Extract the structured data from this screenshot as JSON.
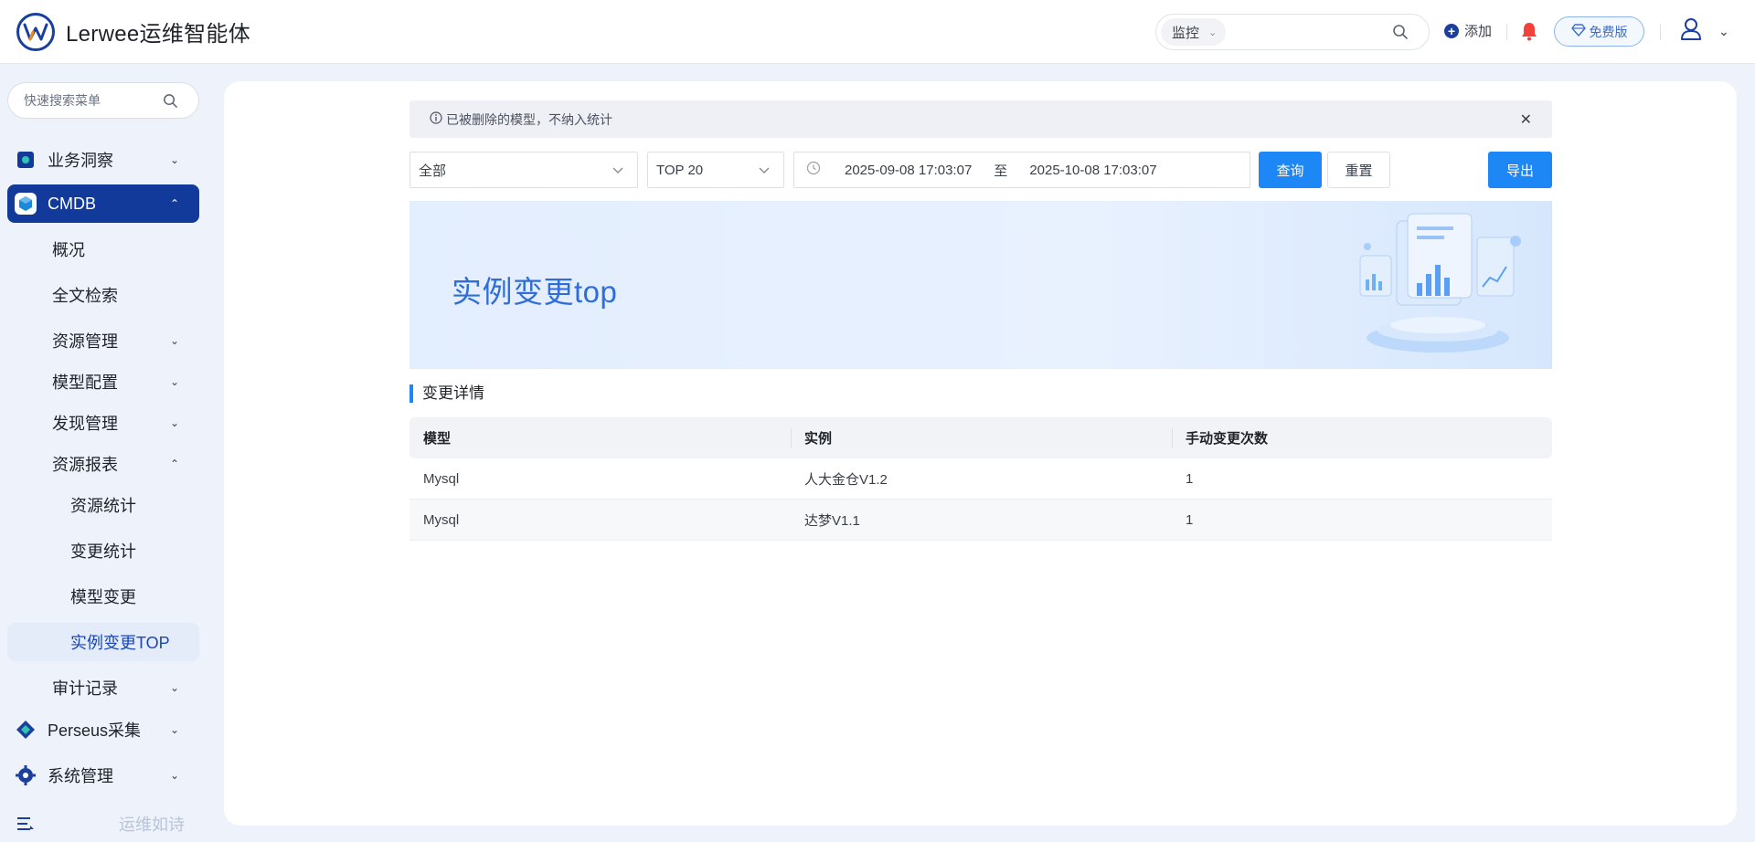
{
  "header": {
    "app_title": "Lerwee运维智能体",
    "search_scope": "监控",
    "add_label": "添加",
    "free_label": "免费版"
  },
  "sidebar": {
    "search_placeholder": "快速搜索菜单",
    "items": [
      {
        "label": "业务洞察",
        "icon": "business-insight-icon"
      },
      {
        "label": "CMDB",
        "icon": "cmdb-cube-icon"
      },
      {
        "label": "概况"
      },
      {
        "label": "全文检索"
      },
      {
        "label": "资源管理"
      },
      {
        "label": "模型配置"
      },
      {
        "label": "发现管理"
      },
      {
        "label": "资源报表"
      },
      {
        "label": "资源统计"
      },
      {
        "label": "变更统计"
      },
      {
        "label": "模型变更"
      },
      {
        "label": "实例变更TOP"
      },
      {
        "label": "审计记录"
      },
      {
        "label": "Perseus采集",
        "icon": "perseus-icon"
      },
      {
        "label": "系统管理",
        "icon": "gear-icon"
      }
    ],
    "footer_text": "运维如诗"
  },
  "main": {
    "alert_text": "已被删除的模型，不纳入统计",
    "filters": {
      "model_select": "全部",
      "top_select": "TOP 20",
      "date_start": "2025-09-08 17:03:07",
      "date_sep": "至",
      "date_end": "2025-10-08 17:03:07",
      "query_label": "查询",
      "reset_label": "重置",
      "export_label": "导出"
    },
    "banner_title": "实例变更top",
    "section_title": "变更详情",
    "table": {
      "columns": [
        "模型",
        "实例",
        "手动变更次数"
      ],
      "rows": [
        [
          "Mysql",
          "人大金仓V1.2",
          "1"
        ],
        [
          "Mysql",
          "达梦V1.1",
          "1"
        ]
      ]
    }
  },
  "colors": {
    "primary": "#1c87f5",
    "nav_active": "#123a9b",
    "banner_title": "#2f6ed8",
    "bell": "#f5413b"
  }
}
